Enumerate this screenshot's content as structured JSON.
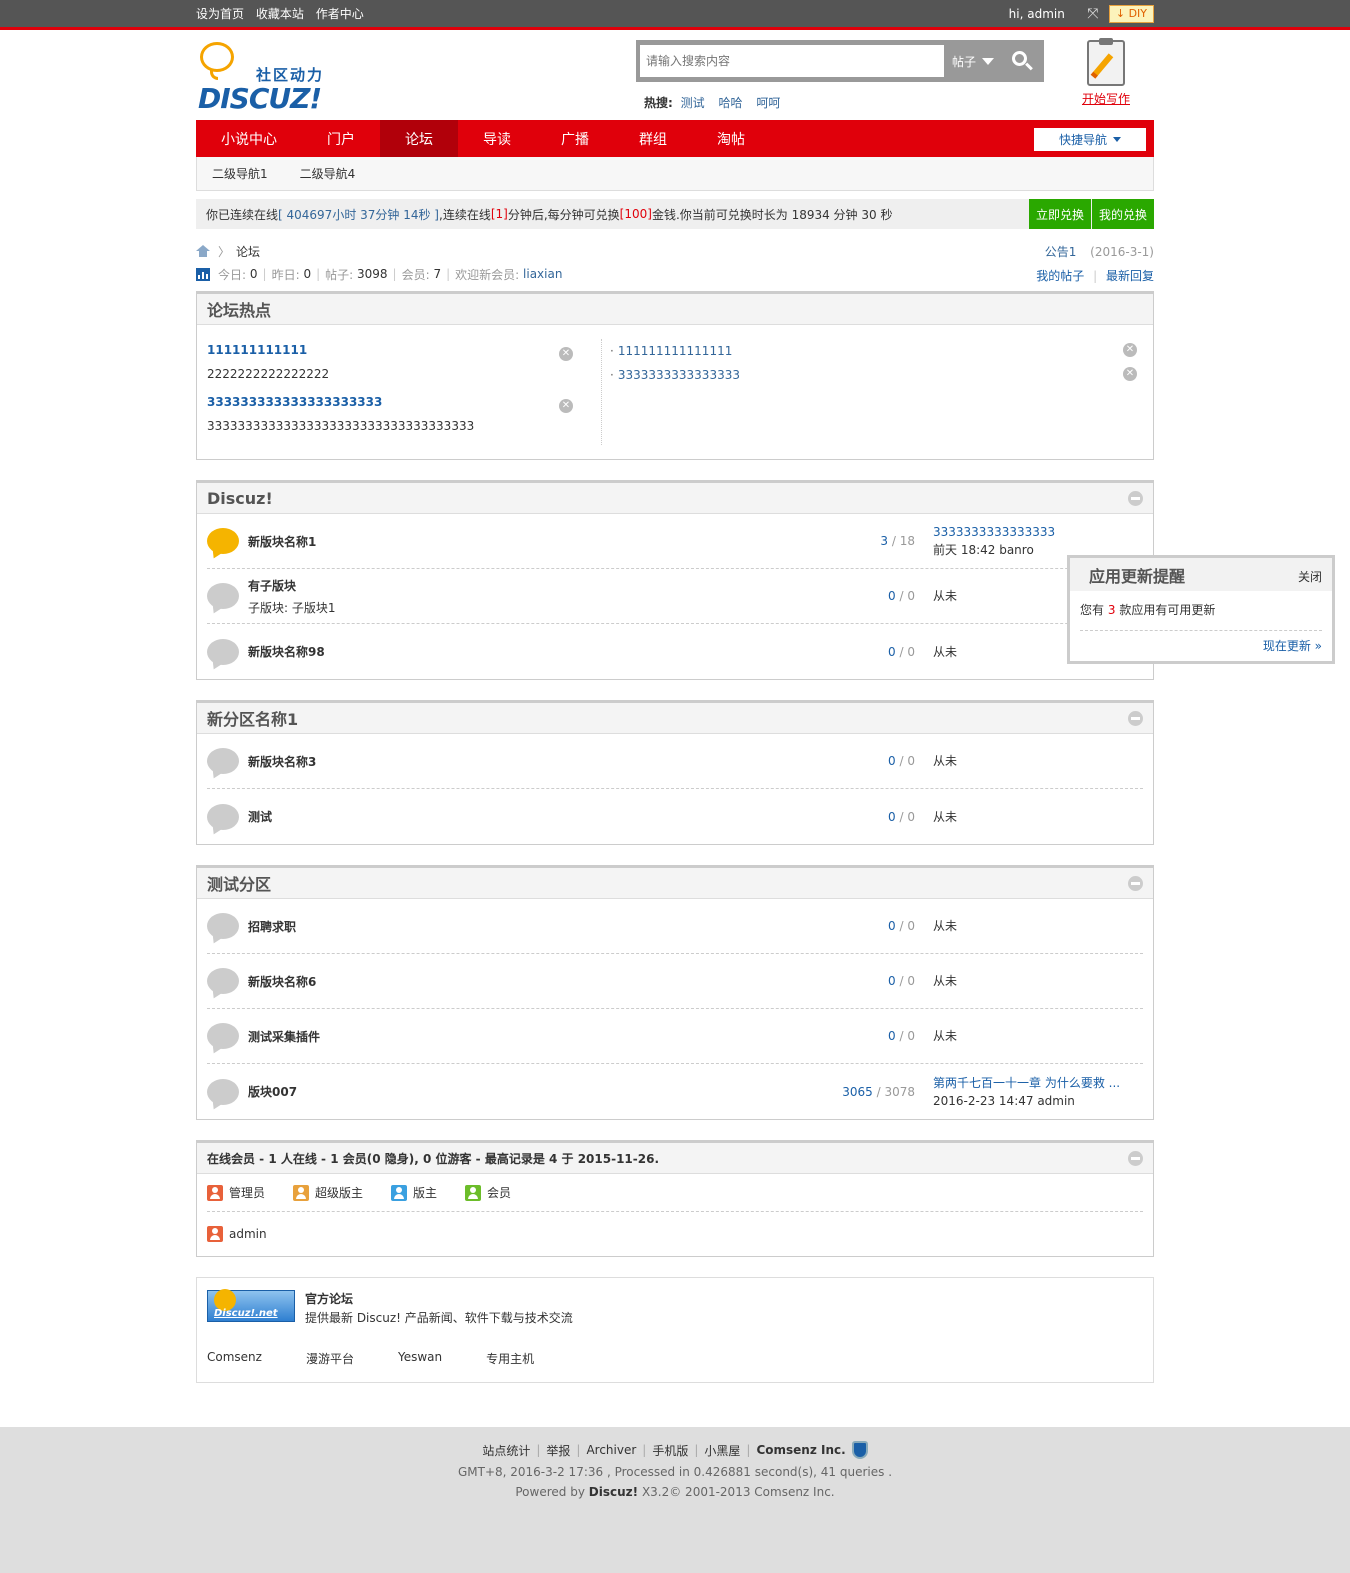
{
  "topbar": {
    "links": [
      "设为首页",
      "收藏本站",
      "作者中心"
    ],
    "greeting": "hi, admin",
    "diy_label": "DIY"
  },
  "header": {
    "logo_cn": "社区动力",
    "logo_en": "DISCUZ!",
    "search_placeholder": "请输入搜索内容",
    "search_type": "帖子",
    "hot_label": "热搜:",
    "hot_terms": [
      "测试",
      "哈哈",
      "呵呵"
    ],
    "write_label": "开始写作"
  },
  "nav": {
    "items": [
      "小说中心",
      "门户",
      "论坛",
      "导读",
      "广播",
      "群组",
      "淘帖"
    ],
    "active_index": 2,
    "quick_nav": "快捷导航"
  },
  "subnav": {
    "items": [
      "二级导航1",
      "二级导航4"
    ]
  },
  "exchange": {
    "t1": "你已连续在线",
    "online_time": "[ 404697小时 37分钟 14秒 ]",
    "t2": ",连续在线",
    "minutes": "[1]",
    "t3": "分钟后,每分钟可兑换",
    "amount": "[100]",
    "t4": "金钱.你当前可兑换时长为 18934 分钟 30 秒",
    "btn_now": "立即兑换",
    "btn_mine": "我的兑换"
  },
  "breadcrumb": {
    "current": "论坛",
    "notice": "公告1",
    "notice_date": "(2016-3-1)"
  },
  "stats": {
    "today_label": "今日:",
    "today": "0",
    "yesterday_label": "昨日:",
    "yesterday": "0",
    "posts_label": "帖子:",
    "posts": "3098",
    "members_label": "会员:",
    "members": "7",
    "welcome_label": "欢迎新会员:",
    "new_member": "liaxian",
    "my_posts": "我的帖子",
    "latest_replies": "最新回复"
  },
  "hot": {
    "title": "论坛热点",
    "items": [
      {
        "title": "111111111111",
        "desc": "2222222222222222"
      },
      {
        "title": "333333333333333333333",
        "desc": "33333333333333333333333333333333333"
      }
    ],
    "list": [
      "111111111111111",
      "3333333333333333"
    ]
  },
  "categories": [
    {
      "title": "Discuz!",
      "forums": [
        {
          "name": "新版块名称1",
          "sub": "",
          "threads": "3",
          "posts": "18",
          "last_title": "3333333333333333",
          "last_meta": "前天 18:42 banro",
          "new": true
        },
        {
          "name": "有子版块",
          "sub": "子版块: 子版块1",
          "threads": "0",
          "posts": "0",
          "last_title": "",
          "last_meta": "从未",
          "new": false
        },
        {
          "name": "新版块名称98",
          "sub": "",
          "threads": "0",
          "posts": "0",
          "last_title": "",
          "last_meta": "从未",
          "new": false
        }
      ]
    },
    {
      "title": "新分区名称1",
      "forums": [
        {
          "name": "新版块名称3",
          "sub": "",
          "threads": "0",
          "posts": "0",
          "last_title": "",
          "last_meta": "从未",
          "new": false
        },
        {
          "name": "测试",
          "sub": "",
          "threads": "0",
          "posts": "0",
          "last_title": "",
          "last_meta": "从未",
          "new": false
        }
      ]
    },
    {
      "title": "测试分区",
      "forums": [
        {
          "name": "招聘求职",
          "sub": "",
          "threads": "0",
          "posts": "0",
          "last_title": "",
          "last_meta": "从未",
          "new": false
        },
        {
          "name": "新版块名称6",
          "sub": "",
          "threads": "0",
          "posts": "0",
          "last_title": "",
          "last_meta": "从未",
          "new": false
        },
        {
          "name": "测试采集插件",
          "sub": "",
          "threads": "0",
          "posts": "0",
          "last_title": "",
          "last_meta": "从未",
          "new": false
        },
        {
          "name": "版块007",
          "sub": "",
          "threads": "3065",
          "posts": "3078",
          "last_title": "第两千七百一十一章 为什么要救 ...",
          "last_meta": "2016-2-23 14:47 admin",
          "new": false
        }
      ]
    }
  ],
  "online": {
    "header": "在线会员 - 1 人在线 - 1 会员(0 隐身), 0 位游客 - 最高记录是 4 于 2015-11-26.",
    "legend": [
      {
        "label": "管理员",
        "color": "#e8613a"
      },
      {
        "label": "超级版主",
        "color": "#e8a13c"
      },
      {
        "label": "版主",
        "color": "#3aa0e0"
      },
      {
        "label": "会员",
        "color": "#6cbd2a"
      }
    ],
    "users": [
      "admin"
    ]
  },
  "links": {
    "official_logo": "Discuz!.net",
    "official_title": "官方论坛",
    "official_desc": "提供最新 Discuz! 产品新闻、软件下载与技术交流",
    "friends": [
      "Comsenz",
      "漫游平台",
      "Yeswan",
      "专用主机"
    ]
  },
  "footer": {
    "links": [
      "站点统计",
      "举报",
      "Archiver",
      "手机版",
      "小黑屋"
    ],
    "company": "Comsenz Inc.",
    "processed": "GMT+8, 2016-3-2 17:36 , Processed in 0.426881 second(s), 41 queries .",
    "powered_prefix": "Powered by",
    "powered_brand": "Discuz!",
    "powered_suffix": "X3.2© 2001-2013 Comsenz Inc."
  },
  "popup": {
    "title": "应用更新提醒",
    "close": "关闭",
    "t1": "您有",
    "count": "3",
    "t2": "款应用有可用更新",
    "update_now": "现在更新 »"
  }
}
